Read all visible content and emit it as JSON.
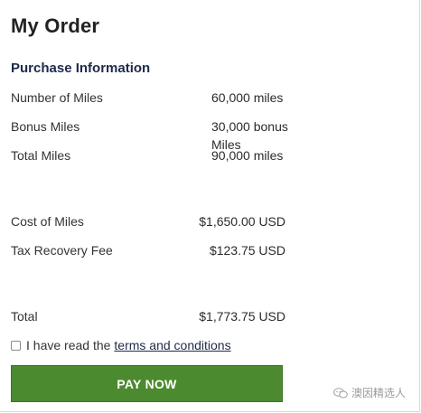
{
  "page": {
    "title": "My Order"
  },
  "purchase": {
    "heading": "Purchase Information",
    "rows": [
      {
        "label": "Number of Miles",
        "value": "60,000 miles"
      },
      {
        "label": "Bonus Miles",
        "value": "30,000 bonus Miles"
      },
      {
        "label": "Total Miles",
        "value": "90,000 miles"
      }
    ]
  },
  "costs": {
    "rows": [
      {
        "label": "Cost of Miles",
        "value": "$1,650.00 USD"
      },
      {
        "label": "Tax Recovery Fee",
        "value": "$123.75 USD"
      }
    ]
  },
  "total": {
    "label": "Total",
    "value": "$1,773.75 USD"
  },
  "terms": {
    "checked": false,
    "prefix": "I have read the",
    "link_text": "terms and conditions"
  },
  "pay_button": {
    "label": "PAY NOW",
    "color": "#4c8a2f"
  },
  "watermark": {
    "text": "澳因精选人"
  }
}
